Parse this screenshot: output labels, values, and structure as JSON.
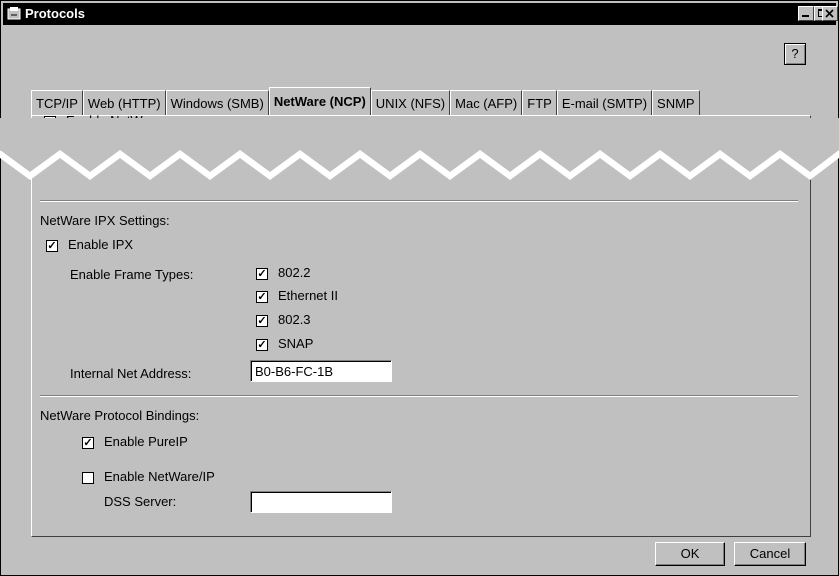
{
  "window": {
    "title": "Protocols",
    "help_label": "?"
  },
  "tabs": [
    {
      "label": "TCP/IP"
    },
    {
      "label": "Web (HTTP)"
    },
    {
      "label": "Windows (SMB)"
    },
    {
      "label": "NetWare (NCP)",
      "active": true
    },
    {
      "label": "UNIX (NFS)"
    },
    {
      "label": "Mac (AFP)"
    },
    {
      "label": "FTP"
    },
    {
      "label": "E-mail (SMTP)"
    },
    {
      "label": "SNMP"
    }
  ],
  "netware": {
    "enable_label": "Enable NetWare",
    "enable_checked": true
  },
  "ipx": {
    "section_title": "NetWare IPX Settings:",
    "enable_label": "Enable IPX",
    "enable_checked": true,
    "frame_types_label": "Enable Frame Types:",
    "frame_types": [
      {
        "label": "802.2",
        "checked": true
      },
      {
        "label": "Ethernet II",
        "checked": true
      },
      {
        "label": "802.3",
        "checked": true
      },
      {
        "label": "SNAP",
        "checked": true
      }
    ],
    "internal_net_label": "Internal Net Address:",
    "internal_net_value": "B0-B6-FC-1B"
  },
  "bindings": {
    "section_title": "NetWare Protocol Bindings:",
    "pureip_label": "Enable PureIP",
    "pureip_checked": true,
    "netwareip_label": "Enable NetWare/IP",
    "netwareip_checked": false,
    "dss_label": "DSS Server:",
    "dss_value": ""
  },
  "buttons": {
    "ok": "OK",
    "cancel": "Cancel"
  },
  "check_glyph": "✓"
}
